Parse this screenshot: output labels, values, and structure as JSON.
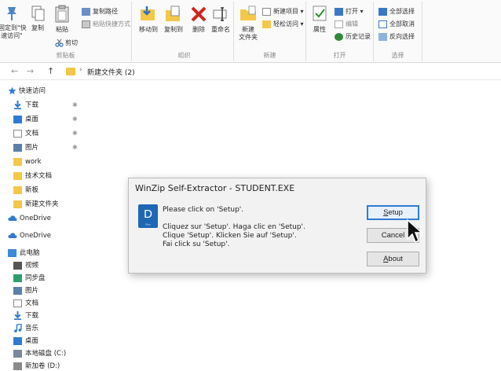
{
  "ribbon": {
    "clipboard": {
      "group_label": "剪贴板",
      "pin_label": "固定到\"快\n速访问\"",
      "copy_label": "复制",
      "paste_label": "粘贴",
      "copy_path_label": "复制路径",
      "paste_shortcut_label": "粘贴快捷方式",
      "cut_label": "剪切"
    },
    "organize": {
      "group_label": "组织",
      "move_to_label": "移动到",
      "copy_to_label": "复制到",
      "delete_label": "删除",
      "rename_label": "重命名"
    },
    "new": {
      "group_label": "新建",
      "new_folder_label": "新建\n文件夹",
      "new_item_label": "新建项目 ▾",
      "easy_access_label": "轻松访问 ▾"
    },
    "open": {
      "group_label": "打开",
      "properties_label": "属性",
      "open_label": "打开 ▾",
      "edit_label": "编辑",
      "history_label": "历史记录"
    },
    "select": {
      "group_label": "选择",
      "select_all_label": "全部选择",
      "select_none_label": "全部取消",
      "invert_label": "反向选择"
    }
  },
  "address": {
    "back": "←",
    "forward": "→",
    "up": "↑",
    "separator": "›",
    "path": "新建文件夹 (2)"
  },
  "sidebar": {
    "quick_access": "快速访问",
    "items": [
      {
        "label": "下载",
        "pinned": true
      },
      {
        "label": "桌面",
        "pinned": true
      },
      {
        "label": "文档",
        "pinned": true
      },
      {
        "label": "图片",
        "pinned": true
      },
      {
        "label": "work"
      },
      {
        "label": "技术文档"
      },
      {
        "label": "新板"
      },
      {
        "label": "新建文件夹"
      }
    ],
    "onedrive_1": "OneDrive",
    "onedrive_2": "OneDrive",
    "this_pc": "此电脑",
    "pc_items": [
      "视频",
      "同步盘",
      "图片",
      "文档",
      "下载",
      "音乐",
      "桌面",
      "本地磁盘 (C:)",
      "新加卷 (D:)"
    ],
    "pin_glyph": "✱"
  },
  "dialog": {
    "title": "WinZip Self-Extractor - STUDENT.EXE",
    "icon_letter": "D",
    "icon_sub": "Pro",
    "line1": "Please click on 'Setup'.",
    "line2": "Cliquez sur 'Setup'.  Haga clic en 'Setup'.",
    "line3": "Clique 'Setup'.  Klicken Sie auf 'Setup'.",
    "line4": "Fai click su 'Setup'.",
    "setup_first": "S",
    "setup_rest": "etup",
    "cancel": "Cancel",
    "about_first": "A",
    "about_rest": "bout"
  }
}
